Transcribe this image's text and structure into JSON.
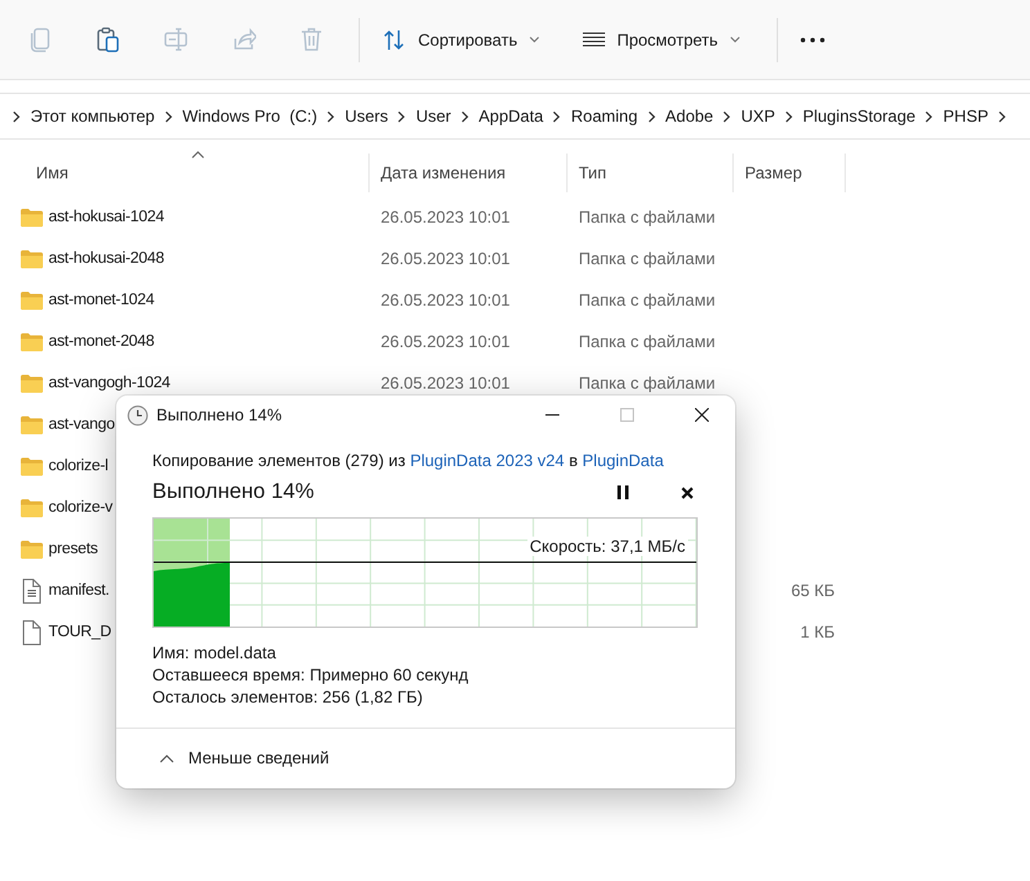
{
  "toolbar": {
    "icon_buttons": [
      {
        "kind": "copy",
        "disabled": true
      },
      {
        "kind": "paste",
        "disabled": false
      },
      {
        "kind": "rename",
        "disabled": true
      },
      {
        "kind": "share",
        "disabled": true
      },
      {
        "kind": "delete",
        "disabled": true
      }
    ],
    "menus": [
      {
        "kind": "sort",
        "label": "Сортировать"
      },
      {
        "kind": "view",
        "label": "Просмотреть"
      }
    ]
  },
  "breadcrumb": [
    "Этот компьютер",
    "Windows Pro  (C:)",
    "Users",
    "User",
    "AppData",
    "Roaming",
    "Adobe",
    "UXP",
    "PluginsStorage",
    "PHSP"
  ],
  "file_list": {
    "columns": [
      {
        "label": "Имя",
        "sorted": true
      },
      {
        "label": "Дата изменения",
        "sorted": false
      },
      {
        "label": "Тип",
        "sorted": false
      },
      {
        "label": "Размер",
        "sorted": false
      }
    ],
    "rows": [
      {
        "kind": "folder",
        "name": "ast-hokusai-1024",
        "modified": "26.05.2023 10:01",
        "type": "Папка с файлами"
      },
      {
        "kind": "folder",
        "name": "ast-hokusai-2048",
        "modified": "26.05.2023 10:01",
        "type": "Папка с файлами"
      },
      {
        "kind": "folder",
        "name": "ast-monet-1024",
        "modified": "26.05.2023 10:01",
        "type": "Папка с файлами"
      },
      {
        "kind": "folder",
        "name": "ast-monet-2048",
        "modified": "26.05.2023 10:01",
        "type": "Папка с файлами"
      },
      {
        "kind": "folder",
        "name": "ast-vangogh-1024",
        "modified": "26.05.2023 10:01",
        "type": "Папка с файлами"
      },
      {
        "kind": "folder",
        "name": "ast-vango"
      },
      {
        "kind": "folder",
        "name": "colorize-l"
      },
      {
        "kind": "folder",
        "name": "colorize-v"
      },
      {
        "kind": "folder",
        "name": "presets"
      },
      {
        "kind": "text",
        "name": "manifest.",
        "size": "65 КБ"
      },
      {
        "kind": "file",
        "name": "TOUR_D",
        "size": "1 КБ"
      }
    ]
  },
  "dialog": {
    "title": "Выполнено 14%",
    "message": [
      {
        "kind": "text",
        "text": "Копирование элементов (279) из "
      },
      {
        "kind": "link",
        "text": "PluginData 2023 v24"
      },
      {
        "kind": "text",
        "text": " в "
      },
      {
        "kind": "link",
        "text": "PluginData"
      }
    ],
    "status": "Выполнено 14%",
    "level": 0.14,
    "speed": "Скорость: 37,1 МБ/с",
    "details": [
      {
        "label": "Имя:",
        "value": "model.data"
      },
      {
        "label": "Оставшееся время:",
        "value": "Примерно 60 секунд"
      },
      {
        "label": "Осталось элементов:",
        "value": "256 (1,82 ГБ)"
      }
    ],
    "toggle": {
      "label": "Меньше сведений",
      "expanded": true
    }
  }
}
